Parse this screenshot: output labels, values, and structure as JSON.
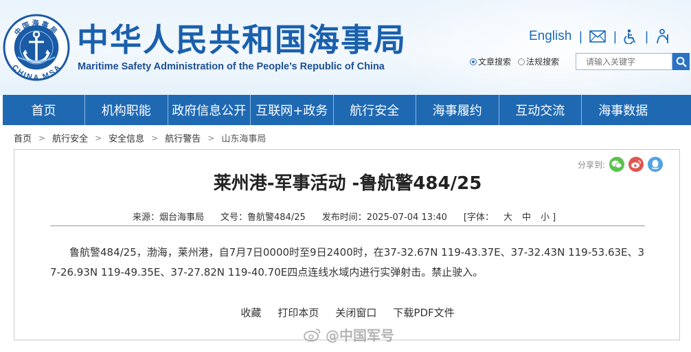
{
  "header": {
    "logo_text_top": "中国海事局",
    "logo_text_bottom": "CHINA MSA",
    "title_cn": "中华人民共和国海事局",
    "title_en": "Maritime Safety Administration of the People’s Republic of China",
    "english_link": "English",
    "search": {
      "option_article": "文章搜索",
      "option_law": "法规搜索",
      "placeholder": "请输入关键字"
    }
  },
  "nav": {
    "items": [
      "首页",
      "机构职能",
      "政府信息公开",
      "互联网+政务",
      "航行安全",
      "海事履约",
      "互动交流",
      "海事数据"
    ]
  },
  "breadcrumb": {
    "items": [
      "首页",
      "航行安全",
      "安全信息",
      "航行警告",
      "山东海事局"
    ]
  },
  "article": {
    "share_label": "分享到:",
    "title": "莱州港-军事活动 -鲁航警484/25",
    "meta": {
      "source": "来源：烟台海事局",
      "doc_no": "文号：鲁航警484/25",
      "publish_time": "发布时间：2025-07-04 13:40",
      "font_label": "[字体：",
      "font_large": "大",
      "font_medium": "中",
      "font_small": "小 ]"
    },
    "body": "鲁航警484/25，渤海，莱州港，自7月7日0000时至9日2400时，在37-32.67N 119-43.37E、37-32.43N 119-53.63E、37-26.93N 119-49.35E、37-27.82N 119-40.70E四点连线水域内进行实弹射击。禁止驶入。",
    "actions": {
      "favorite": "收藏",
      "print": "打印本页",
      "close": "关闭窗口",
      "download_pdf": "下载PDF文件"
    }
  },
  "watermark": {
    "text": "@中国军号"
  },
  "colors": {
    "brand_blue": "#1f69b3",
    "title_blue": "#1a60ad",
    "wechat_green": "#5ac24f",
    "weibo_red": "#e0574f",
    "qq_blue": "#4fa3e3"
  }
}
